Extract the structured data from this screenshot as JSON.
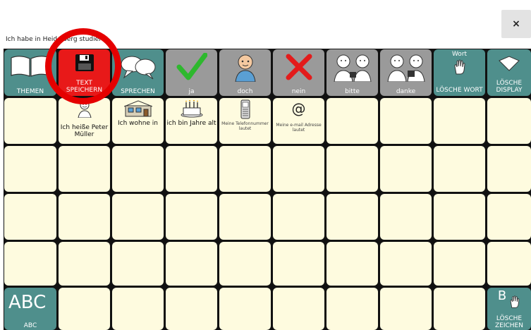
{
  "message_bar": {
    "text": "Ich habe in Heidelberg studiert.",
    "close": "×"
  },
  "toolbar": {
    "themen": "THEMEN",
    "text_speichern": "TEXT SPEICHERN",
    "sprechen": "SPRECHEN",
    "ja": "ja",
    "doch": "doch",
    "nein": "nein",
    "bitte": "bitte",
    "danke": "danke",
    "loesche_wort_top": "Wort",
    "loesche_wort": "LÖSCHE WORT",
    "loesche_display": "LÖSCHE DISPLAY"
  },
  "phrases": {
    "name": "Ich heiße Peter Müller",
    "wohne": "Ich wohne in",
    "alter": "ich bin Jahre alt",
    "telefon": "Meine Telefonnummer lautet",
    "email": "Meine e-mail Adresse lautet",
    "at_symbol": "@"
  },
  "bottom": {
    "abc_big": "ABC",
    "abc": "ABC",
    "zeichen_top": "B",
    "loesche_zeichen": "LÖSCHE ZEICHEN"
  },
  "colors": {
    "teal": "#4f8f8c",
    "gray": "#9a9a9a",
    "cream": "#fefbdf",
    "highlight": "#e81919",
    "circle": "#e50000"
  }
}
